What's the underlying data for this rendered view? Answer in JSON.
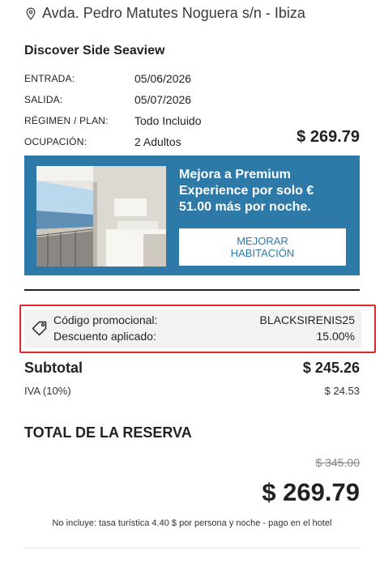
{
  "address": {
    "text": "Avda. Pedro Matutes Noguera s/n - Ibiza",
    "icon": "location-pin-icon"
  },
  "hotel": {
    "name": "Discover Side Seaview"
  },
  "details": [
    {
      "label": "ENTRADA:",
      "value": "05/06/2026"
    },
    {
      "label": "SALIDA:",
      "value": "05/07/2026"
    },
    {
      "label": "RÉGIMEN / PLAN:",
      "value": "Todo Incluido"
    },
    {
      "label": "OCUPACIÓN:",
      "value": "2 Adultos"
    }
  ],
  "room_price": "$ 269.79",
  "upsell": {
    "text": "Mejora a Premium Experience por solo € 51.00 más por noche.",
    "button_line1": "MEJORAR",
    "button_line2": "HABITACIÓN",
    "bg_color": "#2d7aa8"
  },
  "promo": {
    "code_label": "Código promocional:",
    "code_value": "BLACKSIRENIS25",
    "discount_label": "Descuento aplicado:",
    "discount_value": "15.00%",
    "highlight_color": "#e0262d",
    "icon": "tag-icon"
  },
  "subtotal": {
    "label": "Subtotal",
    "value": "$ 245.26"
  },
  "iva": {
    "label": "IVA (10%)",
    "value": "$ 24.53"
  },
  "total": {
    "label": "TOTAL DE LA RESERVA",
    "old_price": "$ 345.00",
    "final_price": "$ 269.79"
  },
  "note": "No incluye: tasa turística 4.40 $ por persona y noche - pago en el hotel"
}
